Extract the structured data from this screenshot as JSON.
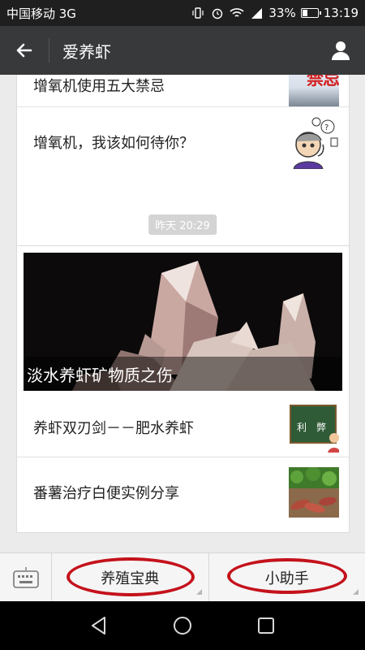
{
  "status_bar": {
    "carrier": "中国移动 3G",
    "battery_text": "33%",
    "battery_level": 0.33,
    "time": "13:19",
    "icons": [
      "vibrate-icon",
      "alarm-icon",
      "wifi-icon",
      "signal-3g-icon",
      "battery-icon"
    ]
  },
  "title_bar": {
    "title": "爱养虾",
    "back_icon": "back-arrow-icon",
    "profile_icon": "person-icon"
  },
  "messages": {
    "card1": {
      "items": [
        {
          "title": "增氧机使用五大禁忌",
          "thumb_text": "禁忌"
        },
        {
          "title": "增氧机，我该如何待你？"
        }
      ]
    },
    "timestamp": "昨天 20:29",
    "card2": {
      "hero_caption": "淡水养虾矿物质之伤",
      "items": [
        {
          "title": "养虾双刃剑－－肥水养虾",
          "thumb_text": [
            "利",
            "弊"
          ]
        },
        {
          "title": "番薯治疗白便实例分享"
        }
      ]
    }
  },
  "bottom_menu": {
    "keyboard_icon": "keyboard-icon",
    "items": [
      {
        "label": "养殖宝典"
      },
      {
        "label": "小助手"
      }
    ],
    "highlight_color": "#c4121b"
  },
  "nav_bar": {
    "icons": [
      "back-triangle-icon",
      "home-circle-icon",
      "recents-square-icon"
    ]
  }
}
